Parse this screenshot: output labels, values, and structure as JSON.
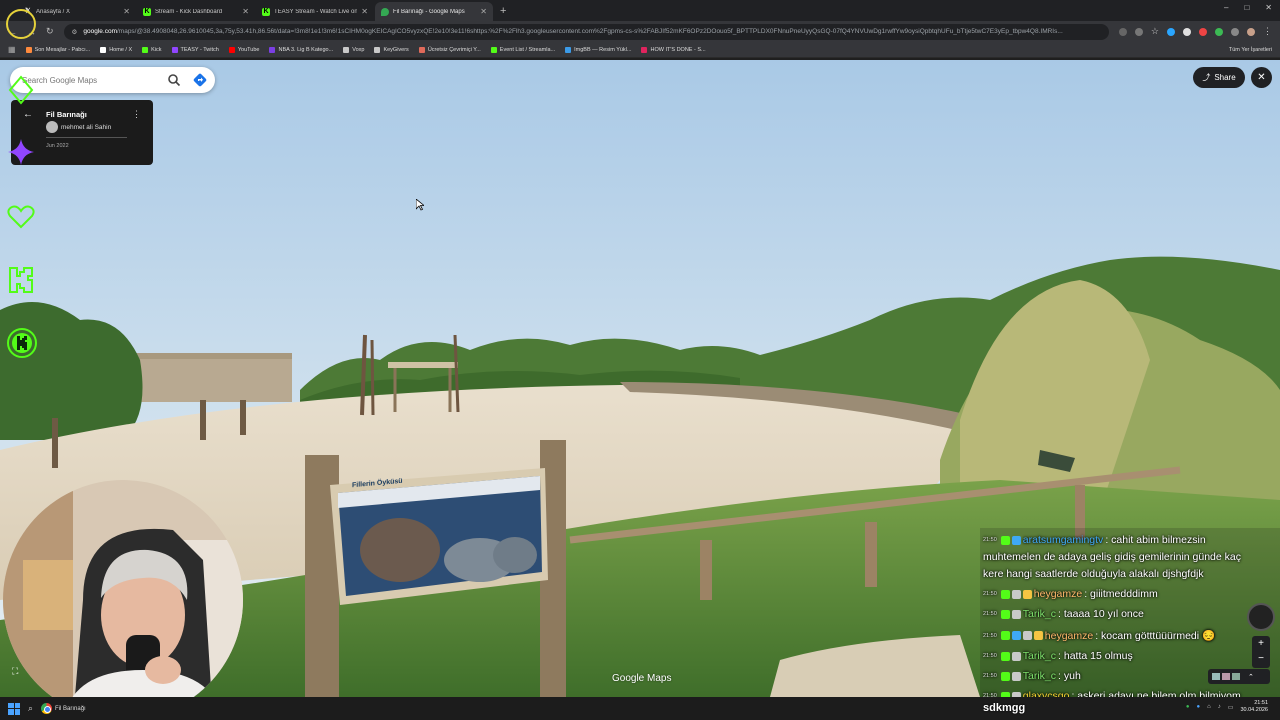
{
  "browser": {
    "tabs": [
      {
        "title": "Anasayfa / X",
        "icon": "x-logo-icon",
        "color": "#ffffff"
      },
      {
        "title": "Stream - Kick Dashboard",
        "icon": "kick-logo-icon",
        "color": "#53fc18"
      },
      {
        "title": "TEASY Stream - Watch Live on Kick",
        "icon": "kick-logo-icon",
        "color": "#53fc18"
      },
      {
        "title": "Fil Barınağı - Google Maps",
        "icon": "google-maps-icon",
        "color": "#34a853",
        "active": true
      }
    ],
    "window_controls": [
      "–",
      "□",
      "✕"
    ],
    "url_host": "google.com",
    "url_rest": "/maps/@38.4908048,26.9610045,3a,75y,53.41h,86.56t/data=!3m8!1e1!3m6!1sCIHM0ogKEICAgICO5vyzxQE!2e10!3e11!6shttps:%2F%2Flh3.googleusercontent.com%2Fgpms-cs-s%2FABJIf52mKF6OPz2DOouo5f_BPTTPLDX0FNnuPneUyyQsGQ-07fQ4YNVUwDg1rwffYw9oysiQpbtqhUFu_bTtje5twC7E3yEp_tbpw4Q8.IMRIs..."
  },
  "bookmarks": [
    {
      "label": "Son Mesajlar - Pabcı...",
      "color": "#ff8a3d"
    },
    {
      "label": "Home / X",
      "color": "#ffffff"
    },
    {
      "label": "Kick",
      "color": "#53fc18"
    },
    {
      "label": "TEASY - Twitch",
      "color": "#9146ff"
    },
    {
      "label": "YouTube",
      "color": "#ff0000"
    },
    {
      "label": "NBA 3. Lig B Katego...",
      "color": "#7b3fe4"
    },
    {
      "label": "Voxp",
      "color": "#c9c9c9"
    },
    {
      "label": "KeyGivers",
      "color": "#c9c9c9"
    },
    {
      "label": "Ücretsiz Çevrimiçi Y...",
      "color": "#e06a5a"
    },
    {
      "label": "Event List / Streamla...",
      "color": "#53fc18"
    },
    {
      "label": "ImgBB — Resim Yükl...",
      "color": "#3b9be8"
    },
    {
      "label": "HOW IT'S DONE - S...",
      "color": "#e0245e"
    }
  ],
  "all_bookmarks": "Tüm Yer İşaretleri",
  "maps": {
    "search_placeholder": "Search Google Maps",
    "place_name": "Fil Barınağı",
    "author": "mehmet ali Sahin",
    "date": "Jun 2022",
    "share_label": "Share",
    "watermark": "Google Maps",
    "sign_text": "Fillerin Öyküsü"
  },
  "chat": {
    "messages": [
      {
        "time": "21:50",
        "user": "aratsumgamingtv",
        "user_color": "#3fa9f5",
        "text": " : cahit abim bilmezsin",
        "badges": [
          "#53fc18",
          "#3fa9f5"
        ]
      },
      {
        "time": "",
        "user": "",
        "user_color": "#ffffff",
        "text": "muhtemelen de adaya geliş gidiş gemilerinin günde kaç",
        "badges": []
      },
      {
        "time": "",
        "user": "",
        "user_color": "#ffffff",
        "text": "kere hangi saatlerde olduğuyla alakalı djshgfdjk",
        "badges": []
      },
      {
        "time": "21:50",
        "user": "heygamze",
        "user_color": "#ffb86b",
        "text": " : giiitmedddimm",
        "badges": [
          "#53fc18",
          "#c9c9c9",
          "#f5c542"
        ]
      },
      {
        "time": "21:50",
        "user": "Tarik_c",
        "user_color": "#7ee06b",
        "text": " : taaaa 10 yıl once",
        "badges": [
          "#53fc18",
          "#c9c9c9"
        ]
      },
      {
        "time": "21:50",
        "user": "heygamze",
        "user_color": "#ffb86b",
        "text": " : kocam götttüüürmedi 😔",
        "badges": [
          "#53fc18",
          "#3fa9f5",
          "#c9c9c9",
          "#f5c542"
        ]
      },
      {
        "time": "21:50",
        "user": "Tarik_c",
        "user_color": "#7ee06b",
        "text": " : hatta 15 olmuş",
        "badges": [
          "#53fc18",
          "#c9c9c9"
        ]
      },
      {
        "time": "21:50",
        "user": "Tarik_c",
        "user_color": "#7ee06b",
        "text": " : yuh",
        "badges": [
          "#53fc18",
          "#c9c9c9"
        ]
      },
      {
        "time": "21:50",
        "user": "glaxycsgo",
        "user_color": "#f5d033",
        "text": " : askeri adayı ne bilem olm bilmiyom",
        "badges": [
          "#53fc18",
          "#c9c9c9"
        ]
      }
    ]
  },
  "streamer_name": "sdkmgg",
  "taskbar": {
    "app_label": "Fil Barınağı",
    "time": "21:51",
    "date": "30.04.2026"
  },
  "colors": {
    "accent_green": "#53fc18",
    "social_icons": [
      "#53fc18",
      "#9146ff",
      "#53fc18",
      "#53fc18",
      "#53fc18"
    ]
  },
  "social_icons": [
    "kick-diamond-icon",
    "twitch-star-icon",
    "heart-icon",
    "kick-logo-icon",
    "kick-circle-icon"
  ]
}
